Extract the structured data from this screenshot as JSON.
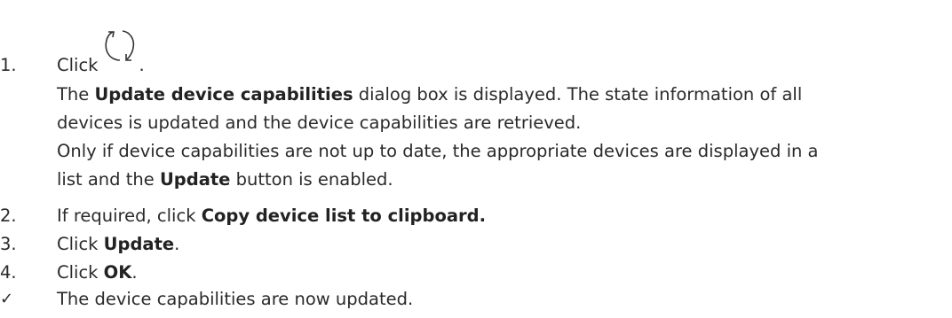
{
  "steps": [
    {
      "num": "1.",
      "pre": "Click",
      "icon": "refresh-arrows-icon",
      "post": ".",
      "para1": {
        "a": "The ",
        "b": "Update device capabilities",
        "c": " dialog box is displayed. The state information of all",
        "d": "devices is updated and the device capabilities are retrieved."
      },
      "para2": {
        "a": "Only if device capabilities are not up to date, the appropriate devices are displayed in a",
        "b": "list and the ",
        "c": "Update",
        "d": " button is enabled."
      }
    },
    {
      "num": "2.",
      "pre": "If required, click ",
      "bold": "Copy device list to clipboard."
    },
    {
      "num": "3.",
      "pre": "Click ",
      "bold": "Update",
      "post": "."
    },
    {
      "num": "4.",
      "pre": "Click ",
      "bold": "OK",
      "post": "."
    }
  ],
  "result": {
    "mark": "✓",
    "text": "The device capabilities are now updated."
  }
}
